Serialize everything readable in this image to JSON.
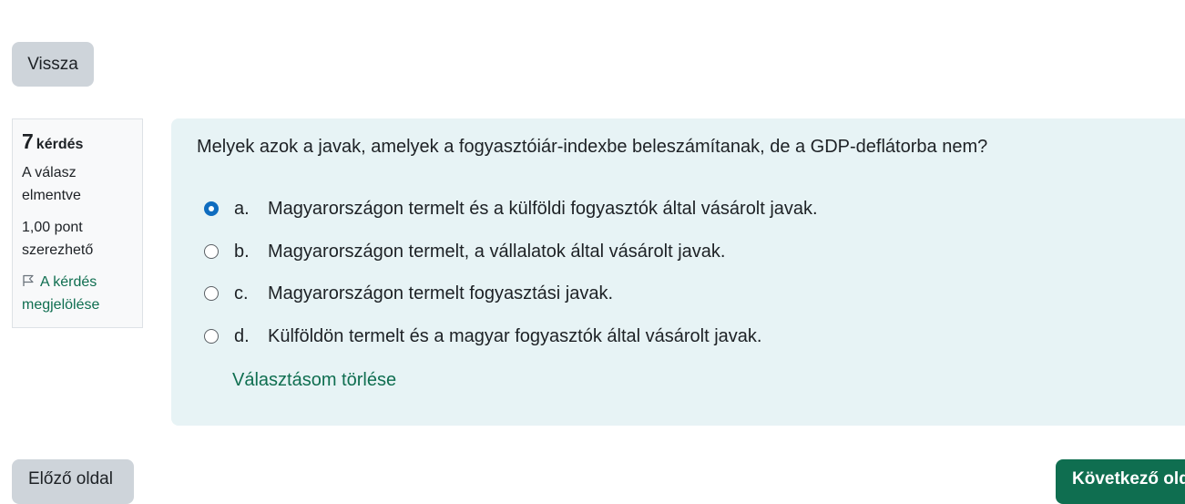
{
  "back_button": "Vissza",
  "question_info": {
    "number": "7",
    "word": "kérdés",
    "state": "A válasz elmentve",
    "grade": "1,00 pont szerezhető",
    "flag_label": "A kérdés megjelölése",
    "flag_icon": "flag-icon"
  },
  "question": {
    "text": "Melyek azok a javak, amelyek a fogyasztóiár-indexbe beleszámítanak, de a GDP-deflátorba nem?",
    "answers": [
      {
        "letter": "a.",
        "text": "Magyarországon termelt és a külföldi fogyasztók által vásárolt javak.",
        "selected": true
      },
      {
        "letter": "b.",
        "text": "Magyarországon termelt, a vállalatok által vásárolt javak.",
        "selected": false
      },
      {
        "letter": "c.",
        "text": "Magyarországon termelt fogyasztási javak.",
        "selected": false
      },
      {
        "letter": "d.",
        "text": "Külföldön termelt és a magyar fogyasztók által vásárolt javak.",
        "selected": false
      }
    ],
    "clear_choice": "Választásom törlése"
  },
  "navigation": {
    "previous": "Előző oldal",
    "next": "Következő oldal"
  },
  "colors": {
    "accent": "#0f6e50",
    "radio_selected": "#0f6cbf",
    "content_bg": "#e7f3f5",
    "button_bg": "#ced4da"
  }
}
